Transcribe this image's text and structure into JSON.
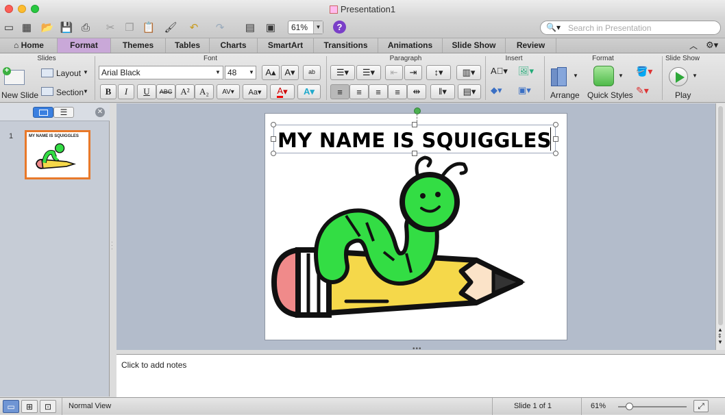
{
  "window": {
    "title": "Presentation1"
  },
  "toolbar": {
    "zoom": "61%",
    "search_placeholder": "Search in Presentation"
  },
  "tabs": [
    {
      "label": "Home"
    },
    {
      "label": "Format"
    },
    {
      "label": "Themes"
    },
    {
      "label": "Tables"
    },
    {
      "label": "Charts"
    },
    {
      "label": "SmartArt"
    },
    {
      "label": "Transitions"
    },
    {
      "label": "Animations"
    },
    {
      "label": "Slide Show"
    },
    {
      "label": "Review"
    }
  ],
  "active_tab": "Format",
  "ribbon": {
    "groups": {
      "slides": "Slides",
      "font": "Font",
      "paragraph": "Paragraph",
      "insert": "Insert",
      "format": "Format",
      "slideshow": "Slide Show"
    },
    "new_slide": "New Slide",
    "layout": "Layout",
    "section": "Section",
    "font_name": "Arial Black",
    "font_size": "48",
    "bold": "B",
    "italic": "I",
    "underline": "U",
    "strikethrough": "ABC",
    "superscript": "A²",
    "subscript": "A₂",
    "arrange": "Arrange",
    "quick_styles": "Quick Styles",
    "play": "Play"
  },
  "thumbnails": [
    {
      "number": "1",
      "title": "MY NAME IS SQUIGGLES"
    }
  ],
  "slide": {
    "title": "MY NAME IS SQUIGGLES"
  },
  "notes": {
    "placeholder": "Click to add notes"
  },
  "status": {
    "view": "Normal View",
    "slide_info": "Slide 1 of 1",
    "zoom": "61%"
  },
  "colors": {
    "active_tab": "#c9a8d8",
    "thumbnail_border": "#e8792a",
    "worm_green": "#33dd44",
    "pencil_yellow": "#f5d84a",
    "eraser_pink": "#f08a8a"
  }
}
